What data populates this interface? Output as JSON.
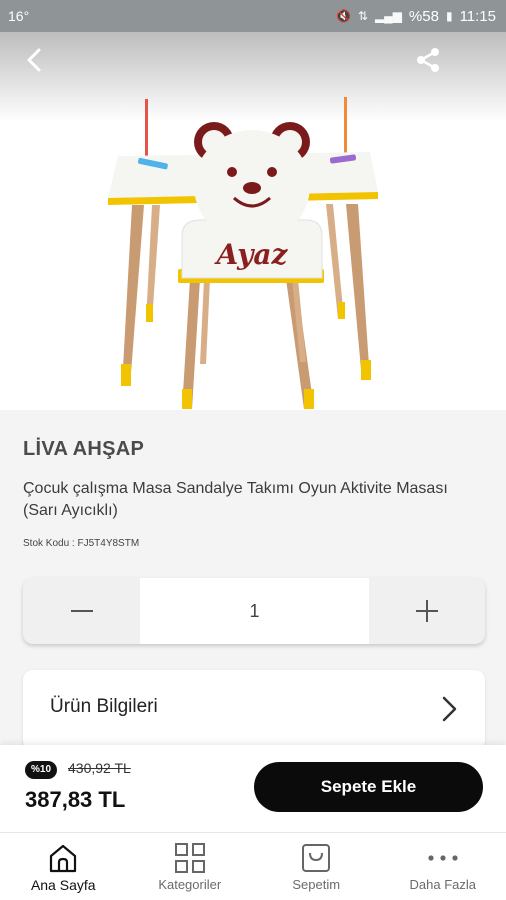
{
  "status_bar": {
    "temperature": "16°",
    "battery": "%58",
    "time": "11:15"
  },
  "product": {
    "brand": "LİVA AHŞAP",
    "title": "Çocuk çalışma Masa Sandalye Takımı Oyun Aktivite Masası (Sarı Ayıcıklı)",
    "stock_code": "Stok Kodu : FJ5T4Y8STM",
    "image_name_text": "Ayaz"
  },
  "quantity": {
    "value": "1"
  },
  "info": {
    "label": "Ürün Bilgileri"
  },
  "cart": {
    "discount_badge": "%10",
    "old_price": "430,92 TL",
    "new_price": "387,83 TL",
    "add_label": "Sepete Ekle"
  },
  "nav": {
    "items": [
      {
        "label": "Ana Sayfa",
        "icon": "home-icon",
        "active": true
      },
      {
        "label": "Kategoriler",
        "icon": "grid-icon",
        "active": false
      },
      {
        "label": "Sepetim",
        "icon": "bag-icon",
        "active": false
      },
      {
        "label": "Daha Fazla",
        "icon": "more-icon",
        "active": false
      }
    ]
  },
  "colors": {
    "accent": "#f2c400",
    "button": "#0b0b0b",
    "status_bar": "#8f9497"
  }
}
